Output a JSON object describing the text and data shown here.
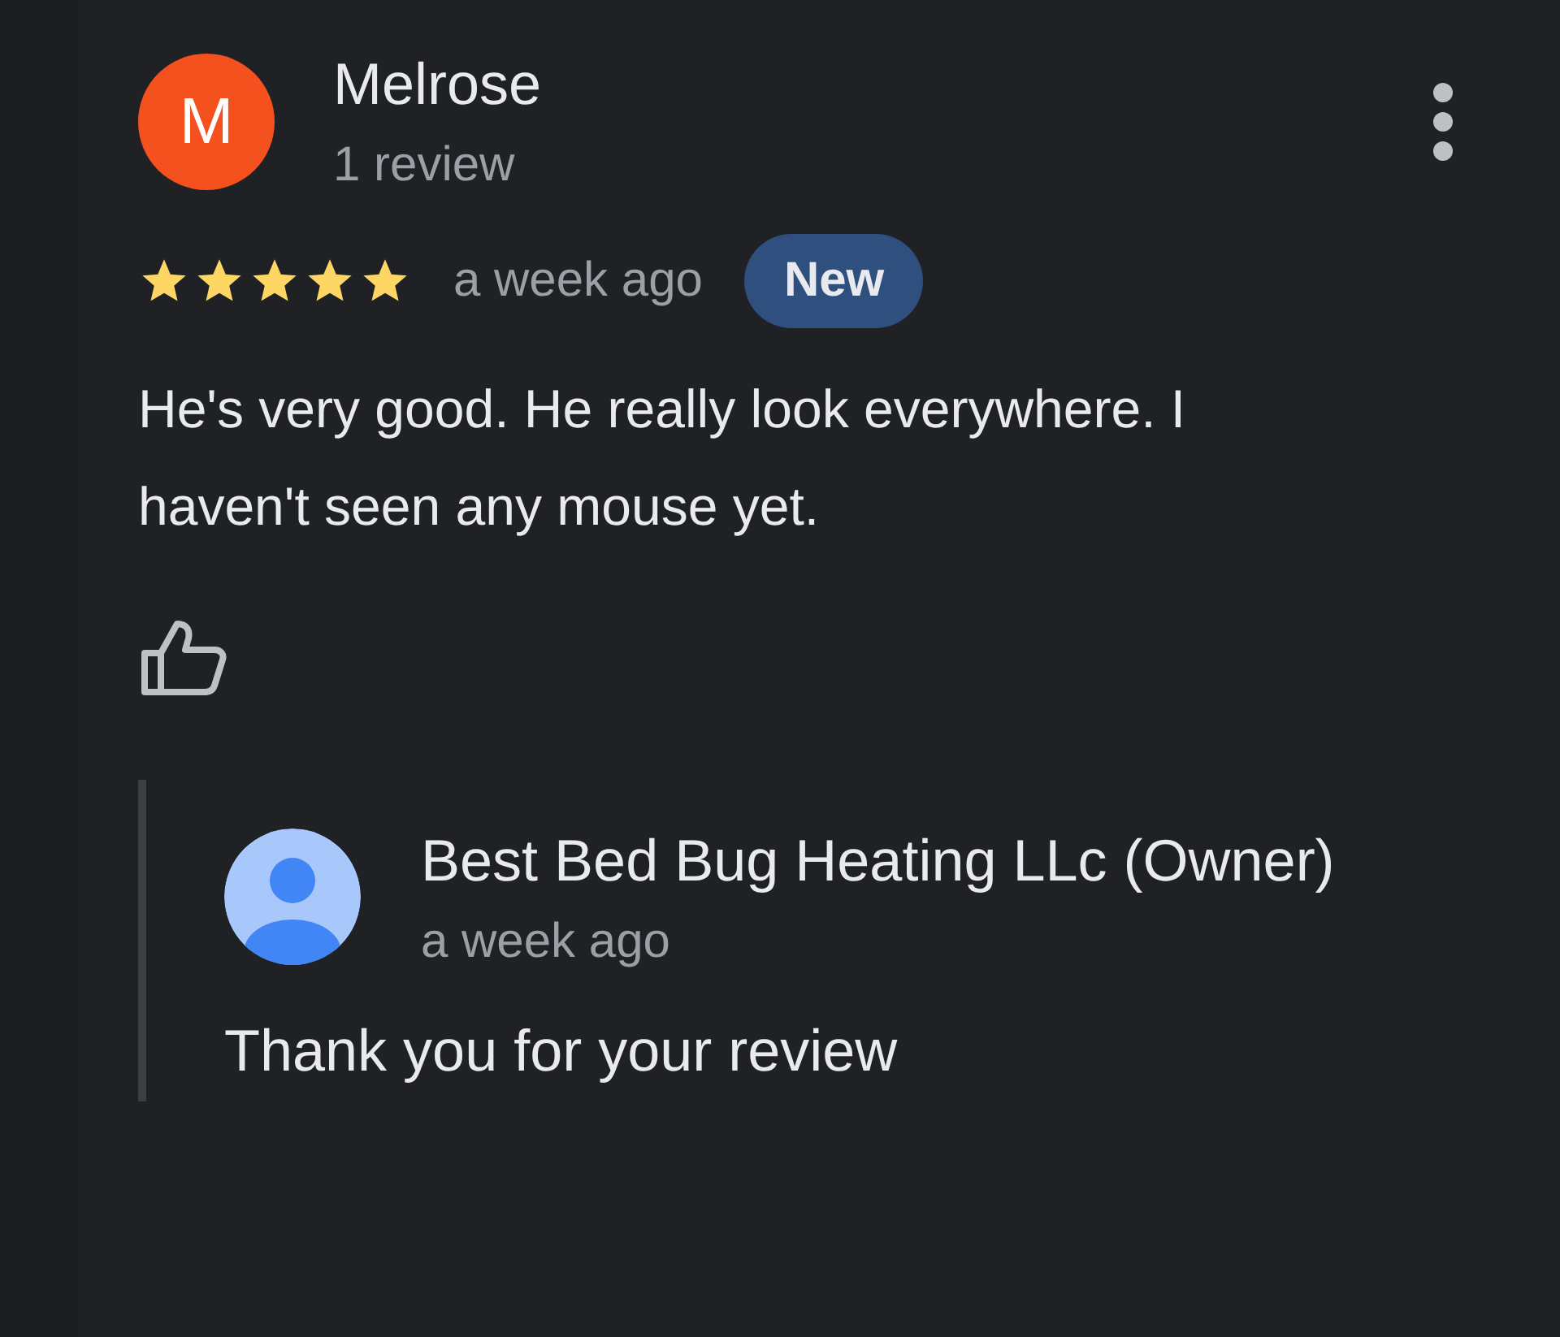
{
  "review": {
    "avatar_letter": "M",
    "author": "Melrose",
    "author_meta": "1 review",
    "stars": 5,
    "time": "a week ago",
    "badge": "New",
    "text": "He's very good. He really look everywhere. I haven't seen any mouse yet."
  },
  "reply": {
    "author": "Best Bed Bug Heating LLc (Owner)",
    "time": "a week ago",
    "text": "Thank you for your review"
  }
}
